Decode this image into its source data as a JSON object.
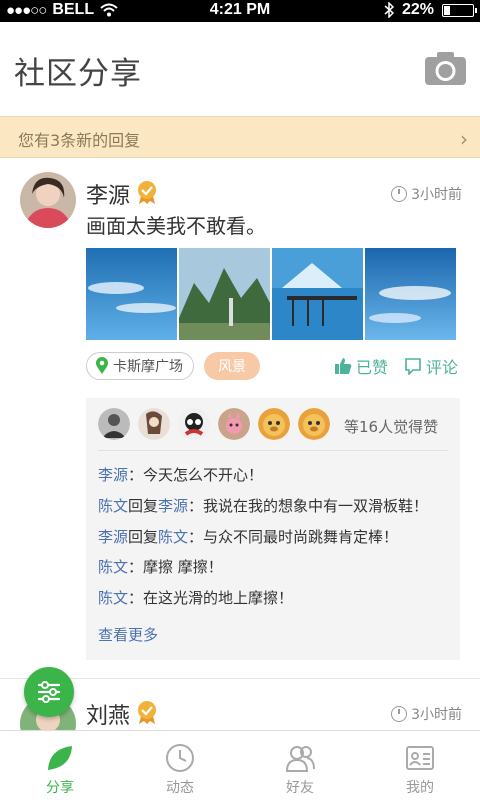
{
  "status_bar": {
    "carrier": "BELL",
    "time": "4:21 PM",
    "battery": "22%",
    "battery_level": 0.22
  },
  "header": {
    "title": "社区分享",
    "camera_icon": "camera-icon"
  },
  "banner": {
    "text": "您有3条新的回复",
    "icon": "chevron-right-icon"
  },
  "post": {
    "author": "李源",
    "time": "3小时前",
    "text": "画面太美我不敢看。",
    "location": "卡斯摩广场",
    "category": "风景",
    "liked_label": "已赞",
    "comment_label": "评论",
    "likes_text": "等16人觉得赞",
    "comments": [
      {
        "name": "李源",
        "text": "：今天怎么不开心！"
      },
      {
        "name": "陈文",
        "mid": "回复",
        "name2": "李源",
        "text": "：我说在我的想象中有一双滑板鞋！"
      },
      {
        "name": "李源",
        "mid": "回复",
        "name2": "陈文",
        "text": "：与众不同最时尚跳舞肯定棒！"
      },
      {
        "name": "陈文",
        "text": "：摩擦 摩擦！"
      },
      {
        "name": "陈文",
        "text": "：在这光滑的地上摩擦！"
      }
    ],
    "more_label": "查看更多"
  },
  "post2": {
    "author": "刘燕",
    "time": "3小时前"
  },
  "tabs": [
    {
      "label": "分享",
      "icon": "leaf-icon",
      "active": true
    },
    {
      "label": "动态",
      "icon": "clock-icon",
      "active": false
    },
    {
      "label": "好友",
      "icon": "friends-icon",
      "active": false
    },
    {
      "label": "我的",
      "icon": "profile-card-icon",
      "active": false
    }
  ],
  "colors": {
    "accent": "#3bb54a",
    "teal": "#4db39a",
    "link": "#4a72b0",
    "banner": "#fbe8c2",
    "tag": "#f7c9a6"
  }
}
